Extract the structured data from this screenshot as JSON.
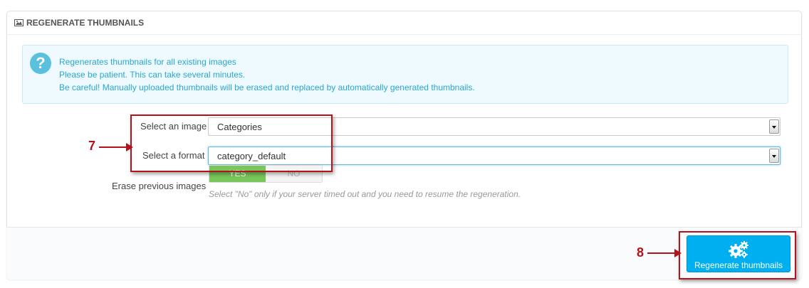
{
  "panel": {
    "heading": "REGENERATE THUMBNAILS",
    "heading_icon": "image-icon"
  },
  "alert": {
    "icon": "question-circle-icon",
    "lines": [
      "Regenerates thumbnails for all existing images",
      "Please be patient. This can take several minutes.",
      "Be careful! Manually uploaded thumbnails will be erased and replaced by automatically generated thumbnails."
    ]
  },
  "form": {
    "image_label": "Select an image",
    "image_value": "Categories",
    "format_label": "Select a format",
    "format_value": "category_default",
    "erase_label": "Erase previous images",
    "erase_yes": "YES",
    "erase_no": "NO",
    "erase_selected": "YES",
    "erase_help": "Select \"No\" only if your server timed out and you need to resume the regeneration."
  },
  "footer": {
    "button_label": "Regenerate thumbnails",
    "button_icon": "gears-icon"
  },
  "callouts": {
    "step_7": "7",
    "step_8": "8"
  },
  "colors": {
    "accent": "#00aff0",
    "alert_text": "#29a7cf",
    "toggle_on": "#79c75a",
    "callout": "#b5121b"
  }
}
